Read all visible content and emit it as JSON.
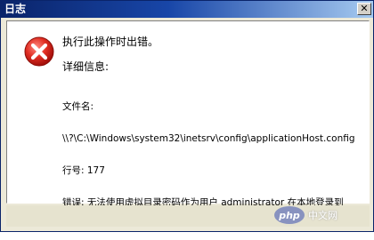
{
  "window": {
    "title": "日志"
  },
  "message": {
    "main": "执行此操作时出错。",
    "details_label": "详细信息:"
  },
  "details": {
    "file_label": "文件名:",
    "file_path": "\\\\?\\C:\\Windows\\system32\\inetsrv\\config\\applicationHost.config",
    "line": "行号: 177",
    "error": "错误: 无法使用虚拟目录密码作为用户 administrator 在本地登录到 C:\\cishan"
  },
  "watermark": {
    "logo": "php",
    "site": "中文网"
  },
  "colors": {
    "title_bar": "#0a246a",
    "icon_red": "#d9261c",
    "dialog_bg": "#ece9d8"
  },
  "icons": [
    "error-icon",
    "close-icon"
  ]
}
